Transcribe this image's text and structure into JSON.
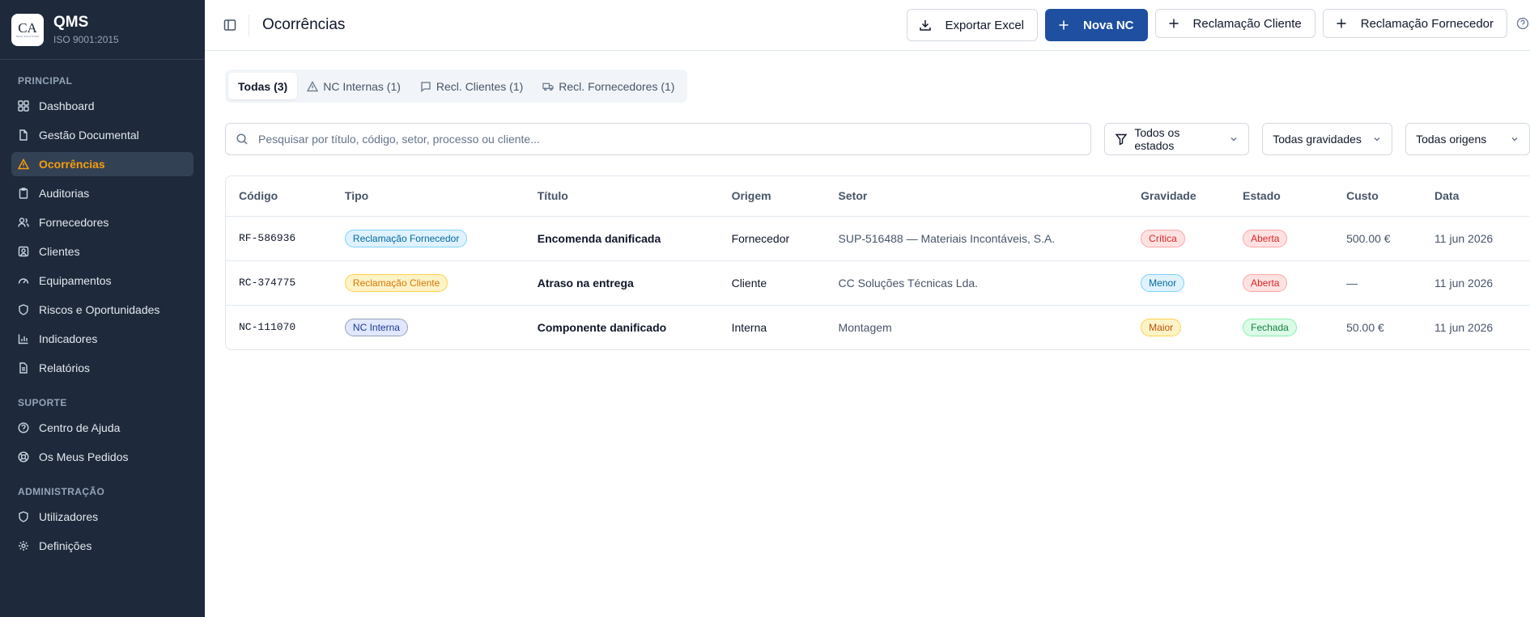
{
  "app": {
    "logo_text": "CA",
    "logo_sub": "TECH SOLUTIONS",
    "title": "QMS",
    "subtitle": "ISO 9001:2015"
  },
  "sidebar": {
    "sections": [
      {
        "label": "PRINCIPAL",
        "items": [
          {
            "label": "Dashboard",
            "icon": "dashboard-icon"
          },
          {
            "label": "Gestão Documental",
            "icon": "document-icon"
          },
          {
            "label": "Ocorrências",
            "icon": "warning-icon",
            "active": true
          },
          {
            "label": "Auditorias",
            "icon": "clipboard-icon"
          },
          {
            "label": "Fornecedores",
            "icon": "users-icon"
          },
          {
            "label": "Clientes",
            "icon": "contact-icon"
          },
          {
            "label": "Equipamentos",
            "icon": "gauge-icon"
          },
          {
            "label": "Riscos e Oportunidades",
            "icon": "shield-icon"
          },
          {
            "label": "Indicadores",
            "icon": "chart-icon"
          },
          {
            "label": "Relatórios",
            "icon": "report-icon"
          }
        ]
      },
      {
        "label": "SUPORTE",
        "items": [
          {
            "label": "Centro de Ajuda",
            "icon": "help-circle-icon"
          },
          {
            "label": "Os Meus Pedidos",
            "icon": "lifebuoy-icon"
          }
        ]
      },
      {
        "label": "ADMINISTRAÇÃO",
        "items": [
          {
            "label": "Utilizadores",
            "icon": "shield-icon"
          },
          {
            "label": "Definições",
            "icon": "gear-icon"
          }
        ]
      }
    ]
  },
  "header": {
    "title": "Ocorrências",
    "export_label": "Exportar Excel",
    "new_nc_label": "Nova NC",
    "client_claim_label": "Reclamação Cliente",
    "supplier_claim_label": "Reclamação Fornecedor"
  },
  "tabs": [
    {
      "label": "Todas (3)",
      "active": true,
      "icon": ""
    },
    {
      "label": "NC Internas (1)",
      "icon": "warning-icon"
    },
    {
      "label": "Recl. Clientes (1)",
      "icon": "message-icon"
    },
    {
      "label": "Recl. Fornecedores (1)",
      "icon": "truck-icon"
    }
  ],
  "filters": {
    "search_placeholder": "Pesquisar por título, código, setor, processo ou cliente...",
    "state": "Todos os estados",
    "severity": "Todas gravidades",
    "origin": "Todas origens"
  },
  "table": {
    "columns": [
      "Código",
      "Tipo",
      "Título",
      "Origem",
      "Setor",
      "Gravidade",
      "Estado",
      "Custo",
      "Data"
    ],
    "rows": [
      {
        "code": "RF-586936",
        "type": "Reclamação Fornecedor",
        "title": "Encomenda danificada",
        "origin": "Fornecedor",
        "sector": "SUP-516488 — Materiais Incontáveis, S.A.",
        "severity": "Crítica",
        "state": "Aberta",
        "cost": "500.00 €",
        "date": "11 jun 2026"
      },
      {
        "code": "RC-374775",
        "type": "Reclamação Cliente",
        "title": "Atraso na entrega",
        "origin": "Cliente",
        "sector": "CC Soluções Técnicas Lda.",
        "severity": "Menor",
        "state": "Aberta",
        "cost": "—",
        "date": "11 jun 2026"
      },
      {
        "code": "NC-111070",
        "type": "NC Interna",
        "title": "Componente danificado",
        "origin": "Interna",
        "sector": "Montagem",
        "severity": "Maior",
        "state": "Fechada",
        "cost": "50.00 €",
        "date": "11 jun 2026"
      }
    ]
  },
  "colors": {
    "sidebar_bg": "#1e293b",
    "accent": "#f59e0b",
    "primary": "#1e4fa0",
    "badge_supplier": "#0284c7",
    "badge_client": "#d97706",
    "badge_internal": "#1e3a8a",
    "critical": "#dc2626",
    "minor": "#0369a1",
    "major": "#b45309",
    "closed": "#15803d"
  }
}
